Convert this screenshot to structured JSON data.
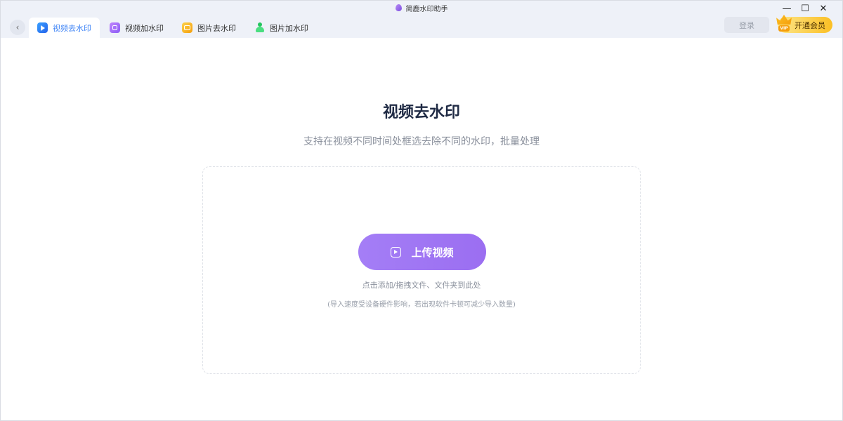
{
  "window": {
    "title": "简鹿水印助手",
    "controls": {
      "minimize": "—",
      "maximize": "☐",
      "close": "✕"
    }
  },
  "nav": {
    "back_icon": "chevron-left-icon",
    "tabs": [
      {
        "label": "视频去水印",
        "icon": "video-remove-icon",
        "active": true
      },
      {
        "label": "视频加水印",
        "icon": "video-add-icon",
        "active": false
      },
      {
        "label": "图片去水印",
        "icon": "image-remove-icon",
        "active": false
      },
      {
        "label": "图片加水印",
        "icon": "image-add-icon",
        "active": false
      }
    ]
  },
  "header": {
    "login_label": "登录",
    "vip_label": "开通会员",
    "vip_tag": "VIP"
  },
  "main": {
    "title": "视频去水印",
    "subtitle": "支持在视频不同时间处框选去除不同的水印，批量处理",
    "upload_label": "上传视频",
    "hint": "点击添加/拖拽文件、文件夹到此处",
    "note": "(导入速度受设备硬件影响，若出现软件卡顿可减少导入数量)"
  },
  "colors": {
    "accent": "#3b82f6",
    "upload_button": "#a47ef6",
    "vip": "#fbbf24",
    "title": "#1f2a44"
  }
}
